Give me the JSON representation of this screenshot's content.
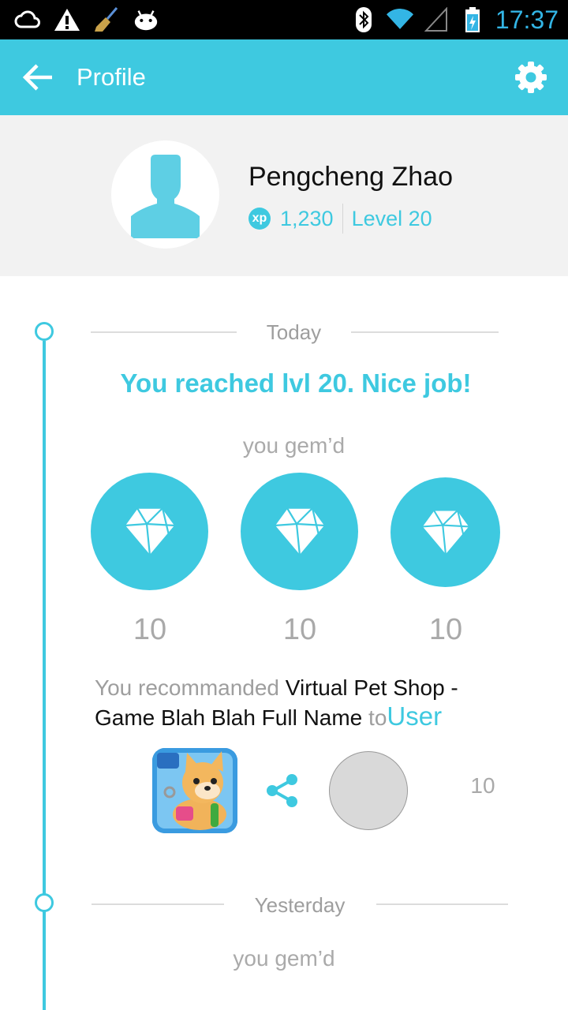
{
  "status_bar": {
    "time": "17:37",
    "icons": [
      "cloud-icon",
      "warning-icon",
      "broom-icon",
      "android-icon",
      "bluetooth-icon",
      "wifi-icon",
      "signal-icon",
      "battery-charging-icon"
    ]
  },
  "appbar": {
    "title": "Profile",
    "back_icon": "arrow-back-icon",
    "settings_icon": "gear-icon",
    "color": "#3ec9e0"
  },
  "profile": {
    "name": "Pengcheng Zhao",
    "xp_badge": "xp",
    "xp": "1,230",
    "level": "Level 20"
  },
  "timeline": {
    "today": {
      "label": "Today",
      "achievement": "You reached lvl 20. Nice job!",
      "gemd_label": "you gem’d",
      "gems": [
        {
          "count": "10"
        },
        {
          "count": "10"
        },
        {
          "count": "10"
        }
      ],
      "recommend": {
        "prefix": "You recommanded",
        "app_name": "Virtual Pet Shop - Game Blah Blah Full Name",
        "to": "to",
        "user": "User",
        "count": "10"
      }
    },
    "yesterday": {
      "label": "Yesterday",
      "gemd_label": "you gem’d"
    }
  }
}
